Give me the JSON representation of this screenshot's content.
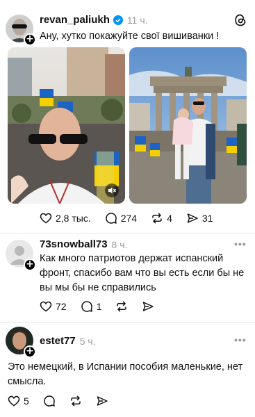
{
  "post": {
    "username": "revan_paliukh",
    "time": "11 ч.",
    "text": "Ану, хутко покажуйте свої вишиванки !",
    "stats": {
      "likes": "2,8 тыс.",
      "comments": "274",
      "reposts": "4",
      "shares": "31"
    }
  },
  "replies": [
    {
      "username": "73snowball73",
      "time": "8 ч.",
      "text": "Как много патриотов держат испанский фронт, спасибо вам что вы есть если бы не вы мы бы не справились",
      "stats": {
        "likes": "72",
        "comments": "1"
      }
    },
    {
      "username": "estet77",
      "time": "5 ч.",
      "text": "Это немецкий, в Испании пособия маленькие, нет смысла.",
      "stats": {
        "likes": "5"
      }
    }
  ],
  "colors": {
    "accent_verified": "#0095f6",
    "secondary_text": "#999999"
  }
}
